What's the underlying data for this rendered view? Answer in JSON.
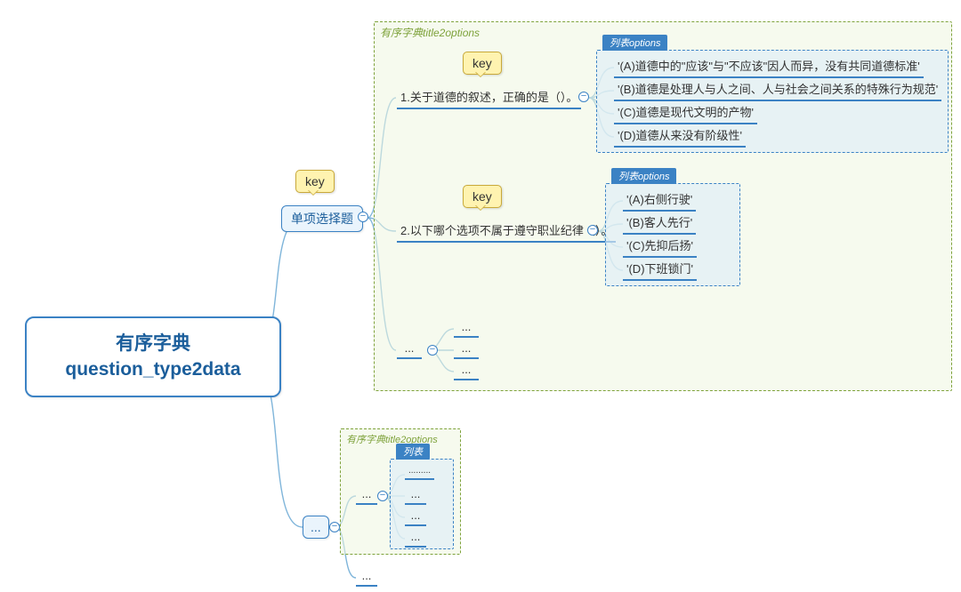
{
  "root": {
    "line1": "有序字典",
    "line2": "question_type2data"
  },
  "labels": {
    "key": "key",
    "title2options": "有序字典title2options",
    "list_options": "列表options",
    "list_short": "列表",
    "ellipsis": "...",
    "dots": "........."
  },
  "children": [
    {
      "label": "单项选择题",
      "questions": [
        {
          "title": "1.关于道德的叙述，正确的是（）。",
          "options": [
            "'(A)道德中的\"应该\"与\"不应该\"因人而异，没有共同道德标准'",
            "'(B)道德是处理人与人之间、人与社会之间关系的特殊行为规范'",
            "'(C)道德是现代文明的产物'",
            "'(D)道德从来没有阶级性'"
          ]
        },
        {
          "title": "2.以下哪个选项不属于遵守职业纪律（）。",
          "options": [
            "'(A)右侧行驶'",
            "'(B)客人先行'",
            "'(C)先抑后扬'",
            "'(D)下班锁门'"
          ]
        }
      ]
    }
  ]
}
